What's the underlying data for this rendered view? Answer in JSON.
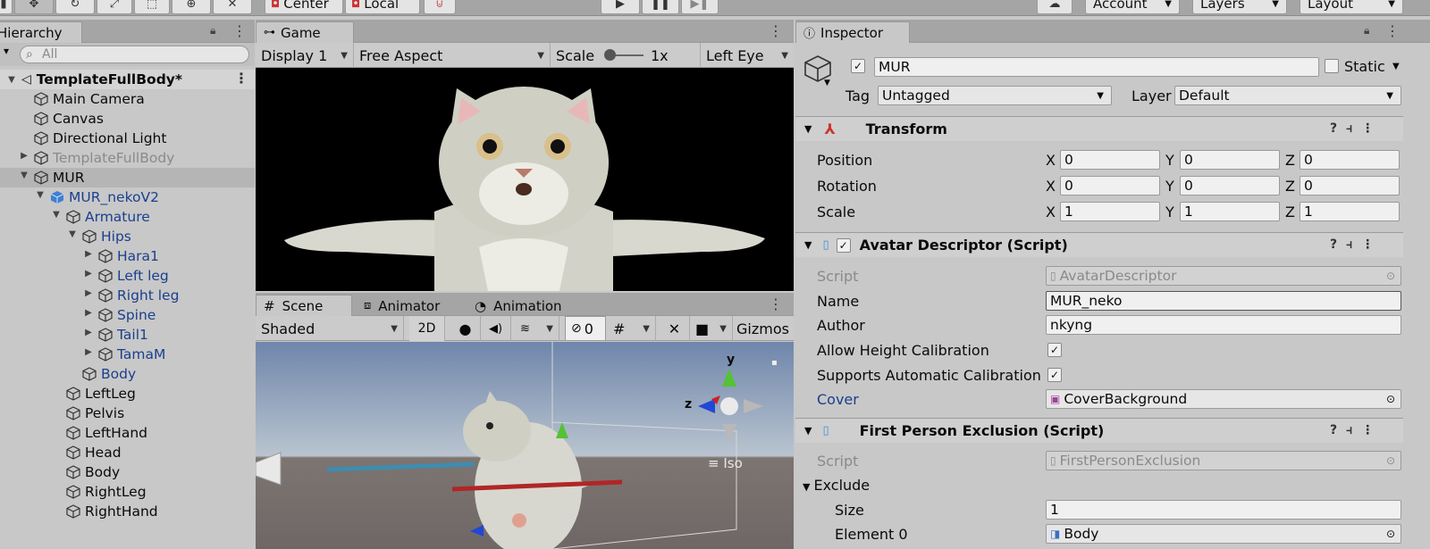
{
  "toolbar": {
    "pivot_label": "Center",
    "space_label": "Local",
    "account_label": "Account",
    "layers_label": "Layers",
    "layout_label": "Layout"
  },
  "hierarchy": {
    "tab_label": "Hierarchy",
    "search_placeholder": "All",
    "scene_name": "TemplateFullBody*",
    "items": [
      {
        "label": "Main Camera"
      },
      {
        "label": "Canvas"
      },
      {
        "label": "Directional Light"
      },
      {
        "label": "TemplateFullBody"
      },
      {
        "label": "MUR"
      },
      {
        "label": "MUR_nekoV2"
      },
      {
        "label": "Armature"
      },
      {
        "label": "Hips"
      },
      {
        "label": "Hara1"
      },
      {
        "label": "Left leg"
      },
      {
        "label": "Right leg"
      },
      {
        "label": "Spine"
      },
      {
        "label": "Tail1"
      },
      {
        "label": "TamaM"
      },
      {
        "label": "Body"
      },
      {
        "label": "LeftLeg"
      },
      {
        "label": "Pelvis"
      },
      {
        "label": "LeftHand"
      },
      {
        "label": "Head"
      },
      {
        "label": "Body"
      },
      {
        "label": "RightLeg"
      },
      {
        "label": "RightHand"
      }
    ]
  },
  "game": {
    "tab_label": "Game",
    "display": "Display 1",
    "aspect": "Free Aspect",
    "scale_label": "Scale",
    "scale_value": "1x",
    "eye": "Left Eye"
  },
  "scene": {
    "tabs": [
      "Scene",
      "Animator",
      "Animation"
    ],
    "shading": "Shaded",
    "mode_2d": "2D",
    "hidden_count": "0",
    "gizmos_label": "Gizmos",
    "projection_label": "Iso",
    "axis_y": "y",
    "axis_z": "z"
  },
  "inspector": {
    "tab_label": "Inspector",
    "object_name": "MUR",
    "static_label": "Static",
    "tag_label": "Tag",
    "tag_value": "Untagged",
    "layer_label": "Layer",
    "layer_value": "Default",
    "transform": {
      "title": "Transform",
      "rows": [
        {
          "label": "Position",
          "x": "0",
          "y": "0",
          "z": "0"
        },
        {
          "label": "Rotation",
          "x": "0",
          "y": "0",
          "z": "0"
        },
        {
          "label": "Scale",
          "x": "1",
          "y": "1",
          "z": "1"
        }
      ],
      "axis_x": "X",
      "axis_y": "Y",
      "axis_z": "Z"
    },
    "avatar": {
      "title": "Avatar Descriptor (Script)",
      "script_label": "Script",
      "script_value": "AvatarDescriptor",
      "name_label": "Name",
      "name_value": "MUR_neko",
      "author_label": "Author",
      "author_value": "nkyng",
      "allow_height_label": "Allow Height Calibration",
      "supports_auto_label": "Supports Automatic Calibration",
      "cover_label": "Cover",
      "cover_value": "CoverBackground"
    },
    "fpe": {
      "title": "First Person Exclusion (Script)",
      "script_label": "Script",
      "script_value": "FirstPersonExclusion",
      "exclude_label": "Exclude",
      "size_label": "Size",
      "size_value": "1",
      "element_label": "Element 0",
      "element_value": "Body"
    }
  },
  "colors": {
    "panel_bg": "#c8c8c8",
    "tabbar_bg": "#a5a5a5",
    "link_blue": "#1b3f8e",
    "selection": "#b5b5b5"
  }
}
